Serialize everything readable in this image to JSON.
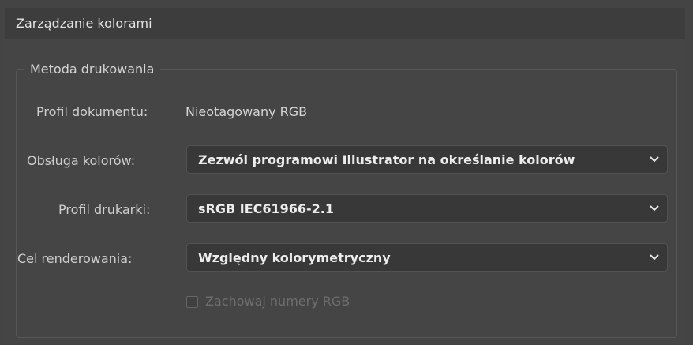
{
  "header": {
    "title": "Zarządzanie kolorami"
  },
  "group": {
    "legend": "Metoda drukowania"
  },
  "document_profile": {
    "label": "Profil dokumentu:",
    "value": "Nieotagowany RGB"
  },
  "color_handling": {
    "label": "Obsługa kolorów:",
    "selected": "Zezwól programowi Illustrator na określanie kolorów"
  },
  "printer_profile": {
    "label": "Profil drukarki:",
    "selected": "sRGB IEC61966-2.1"
  },
  "rendering_intent": {
    "label": "Cel renderowania:",
    "selected": "Względny kolorymetryczny"
  },
  "preserve_rgb": {
    "label": "Zachowaj numery RGB",
    "checked": false,
    "enabled": false
  },
  "icons": {
    "dropdown": "chevron-down-icon"
  },
  "colors": {
    "background": "#444444",
    "field": "#383838",
    "text": "#d3d3d3",
    "disabled": "#6e6e6e"
  }
}
